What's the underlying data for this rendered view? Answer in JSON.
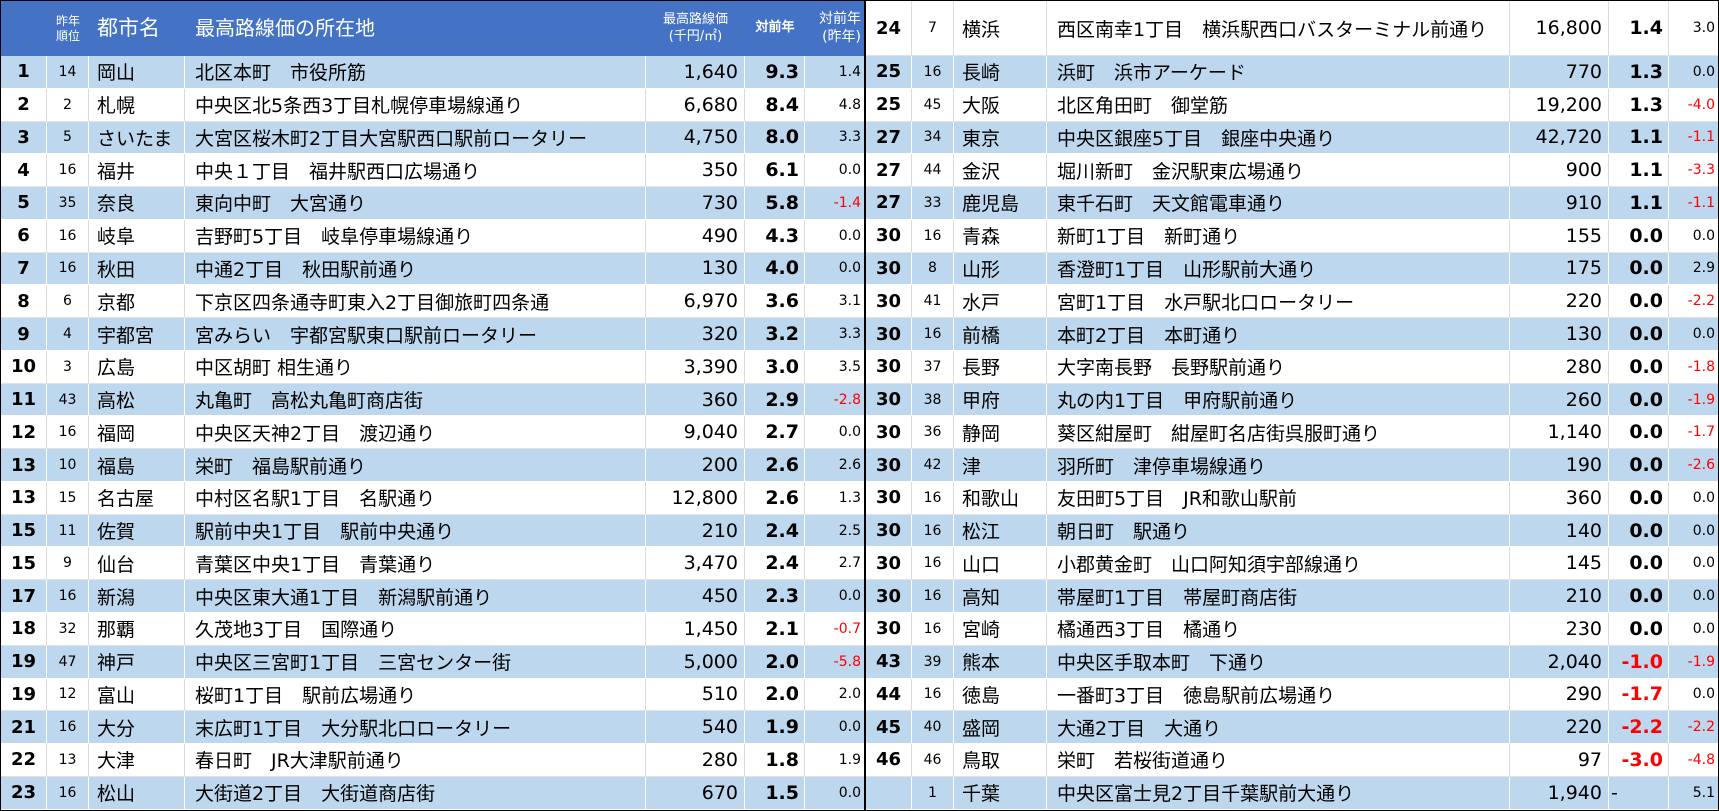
{
  "colors": {
    "header_bg": "#4472C4",
    "header_text": "#FFFFFF",
    "row_shade": "#BDD7EE",
    "negative": "#FF0000"
  },
  "header": {
    "prev_rank_line1": "昨年",
    "prev_rank_line2": "順位",
    "city": "都市名",
    "location": "最高路線価の所在地",
    "price_line1": "最高路線価",
    "price_line2": "(千円/㎡)",
    "yoy": "対前年",
    "yoy_prev_line1": "対前年",
    "yoy_prev_line2": "(昨年)"
  },
  "left_rows": [
    {
      "rank": "1",
      "prev_rank": "14",
      "city": "岡山",
      "location": "北区本町　市役所筋",
      "price": "1,640",
      "yoy": "9.3",
      "yoy_prev": "1.4"
    },
    {
      "rank": "2",
      "prev_rank": "2",
      "city": "札幌",
      "location": "中央区北5条西3丁目札幌停車場線通り",
      "price": "6,680",
      "yoy": "8.4",
      "yoy_prev": "4.8"
    },
    {
      "rank": "3",
      "prev_rank": "5",
      "city": "さいたま",
      "location": "大宮区桜木町2丁目大宮駅西口駅前ロータリー",
      "price": "4,750",
      "yoy": "8.0",
      "yoy_prev": "3.3"
    },
    {
      "rank": "4",
      "prev_rank": "16",
      "city": "福井",
      "location": "中央１丁目　福井駅西口広場通り",
      "price": "350",
      "yoy": "6.1",
      "yoy_prev": "0.0"
    },
    {
      "rank": "5",
      "prev_rank": "35",
      "city": "奈良",
      "location": "東向中町　大宮通り",
      "price": "730",
      "yoy": "5.8",
      "yoy_prev": "-1.4"
    },
    {
      "rank": "6",
      "prev_rank": "16",
      "city": "岐阜",
      "location": "吉野町5丁目　岐阜停車場線通り",
      "price": "490",
      "yoy": "4.3",
      "yoy_prev": "0.0"
    },
    {
      "rank": "7",
      "prev_rank": "16",
      "city": "秋田",
      "location": "中通2丁目　秋田駅前通り",
      "price": "130",
      "yoy": "4.0",
      "yoy_prev": "0.0"
    },
    {
      "rank": "8",
      "prev_rank": "6",
      "city": "京都",
      "location": "下京区四条通寺町東入2丁目御旅町四条通",
      "price": "6,970",
      "yoy": "3.6",
      "yoy_prev": "3.1"
    },
    {
      "rank": "9",
      "prev_rank": "4",
      "city": "宇都宮",
      "location": "宮みらい　宇都宮駅東口駅前ロータリー",
      "price": "320",
      "yoy": "3.2",
      "yoy_prev": "3.3"
    },
    {
      "rank": "10",
      "prev_rank": "3",
      "city": "広島",
      "location": "中区胡町 相生通り",
      "price": "3,390",
      "yoy": "3.0",
      "yoy_prev": "3.5"
    },
    {
      "rank": "11",
      "prev_rank": "43",
      "city": "高松",
      "location": "丸亀町　高松丸亀町商店街",
      "price": "360",
      "yoy": "2.9",
      "yoy_prev": "-2.8"
    },
    {
      "rank": "12",
      "prev_rank": "16",
      "city": "福岡",
      "location": "中央区天神2丁目　渡辺通り",
      "price": "9,040",
      "yoy": "2.7",
      "yoy_prev": "0.0"
    },
    {
      "rank": "13",
      "prev_rank": "10",
      "city": "福島",
      "location": "栄町　福島駅前通り",
      "price": "200",
      "yoy": "2.6",
      "yoy_prev": "2.6"
    },
    {
      "rank": "13",
      "prev_rank": "15",
      "city": "名古屋",
      "location": "中村区名駅1丁目　名駅通り",
      "price": "12,800",
      "yoy": "2.6",
      "yoy_prev": "1.3"
    },
    {
      "rank": "15",
      "prev_rank": "11",
      "city": "佐賀",
      "location": "駅前中央1丁目　駅前中央通り",
      "price": "210",
      "yoy": "2.4",
      "yoy_prev": "2.5"
    },
    {
      "rank": "15",
      "prev_rank": "9",
      "city": "仙台",
      "location": "青葉区中央1丁目　青葉通り",
      "price": "3,470",
      "yoy": "2.4",
      "yoy_prev": "2.7"
    },
    {
      "rank": "17",
      "prev_rank": "16",
      "city": "新潟",
      "location": "中央区東大通1丁目　新潟駅前通り",
      "price": "450",
      "yoy": "2.3",
      "yoy_prev": "0.0"
    },
    {
      "rank": "18",
      "prev_rank": "32",
      "city": "那覇",
      "location": "久茂地3丁目　国際通り",
      "price": "1,450",
      "yoy": "2.1",
      "yoy_prev": "-0.7"
    },
    {
      "rank": "19",
      "prev_rank": "47",
      "city": "神戸",
      "location": "中央区三宮町1丁目　三宮センター街",
      "price": "5,000",
      "yoy": "2.0",
      "yoy_prev": "-5.8"
    },
    {
      "rank": "19",
      "prev_rank": "12",
      "city": "富山",
      "location": "桜町1丁目　駅前広場通り",
      "price": "510",
      "yoy": "2.0",
      "yoy_prev": "2.0"
    },
    {
      "rank": "21",
      "prev_rank": "16",
      "city": "大分",
      "location": "末広町1丁目　大分駅北口ロータリー",
      "price": "540",
      "yoy": "1.9",
      "yoy_prev": "0.0"
    },
    {
      "rank": "22",
      "prev_rank": "13",
      "city": "大津",
      "location": "春日町　JR大津駅前通り",
      "price": "280",
      "yoy": "1.8",
      "yoy_prev": "1.9"
    },
    {
      "rank": "23",
      "prev_rank": "16",
      "city": "松山",
      "location": "大街道2丁目　大街道商店街",
      "price": "670",
      "yoy": "1.5",
      "yoy_prev": "0.0"
    }
  ],
  "right_rows": [
    {
      "rank": "24",
      "prev_rank": "7",
      "city": "横浜",
      "location": "西区南幸1丁目　横浜駅西口バスターミナル前通り",
      "price": "16,800",
      "yoy": "1.4",
      "yoy_prev": "3.0"
    },
    {
      "rank": "25",
      "prev_rank": "16",
      "city": "長崎",
      "location": "浜町　浜市アーケード",
      "price": "770",
      "yoy": "1.3",
      "yoy_prev": "0.0"
    },
    {
      "rank": "25",
      "prev_rank": "45",
      "city": "大阪",
      "location": "北区角田町　御堂筋",
      "price": "19,200",
      "yoy": "1.3",
      "yoy_prev": "-4.0"
    },
    {
      "rank": "27",
      "prev_rank": "34",
      "city": "東京",
      "location": "中央区銀座5丁目　銀座中央通り",
      "price": "42,720",
      "yoy": "1.1",
      "yoy_prev": "-1.1"
    },
    {
      "rank": "27",
      "prev_rank": "44",
      "city": "金沢",
      "location": "堀川新町　金沢駅東広場通り",
      "price": "900",
      "yoy": "1.1",
      "yoy_prev": "-3.3"
    },
    {
      "rank": "27",
      "prev_rank": "33",
      "city": "鹿児島",
      "location": "東千石町　天文館電車通り",
      "price": "910",
      "yoy": "1.1",
      "yoy_prev": "-1.1"
    },
    {
      "rank": "30",
      "prev_rank": "16",
      "city": "青森",
      "location": "新町1丁目　新町通り",
      "price": "155",
      "yoy": "0.0",
      "yoy_prev": "0.0"
    },
    {
      "rank": "30",
      "prev_rank": "8",
      "city": "山形",
      "location": "香澄町1丁目　山形駅前大通り",
      "price": "175",
      "yoy": "0.0",
      "yoy_prev": "2.9"
    },
    {
      "rank": "30",
      "prev_rank": "41",
      "city": "水戸",
      "location": "宮町1丁目　水戸駅北口ロータリー",
      "price": "220",
      "yoy": "0.0",
      "yoy_prev": "-2.2"
    },
    {
      "rank": "30",
      "prev_rank": "16",
      "city": "前橋",
      "location": "本町2丁目　本町通り",
      "price": "130",
      "yoy": "0.0",
      "yoy_prev": "0.0"
    },
    {
      "rank": "30",
      "prev_rank": "37",
      "city": "長野",
      "location": "大字南長野　長野駅前通り",
      "price": "280",
      "yoy": "0.0",
      "yoy_prev": "-1.8"
    },
    {
      "rank": "30",
      "prev_rank": "38",
      "city": "甲府",
      "location": "丸の内1丁目　甲府駅前通り",
      "price": "260",
      "yoy": "0.0",
      "yoy_prev": "-1.9"
    },
    {
      "rank": "30",
      "prev_rank": "36",
      "city": "静岡",
      "location": "葵区紺屋町　紺屋町名店街呉服町通り",
      "price": "1,140",
      "yoy": "0.0",
      "yoy_prev": "-1.7"
    },
    {
      "rank": "30",
      "prev_rank": "42",
      "city": "津",
      "location": "羽所町　津停車場線通り",
      "price": "190",
      "yoy": "0.0",
      "yoy_prev": "-2.6"
    },
    {
      "rank": "30",
      "prev_rank": "16",
      "city": "和歌山",
      "location": "友田町5丁目　JR和歌山駅前",
      "price": "360",
      "yoy": "0.0",
      "yoy_prev": "0.0"
    },
    {
      "rank": "30",
      "prev_rank": "16",
      "city": "松江",
      "location": "朝日町　駅通り",
      "price": "140",
      "yoy": "0.0",
      "yoy_prev": "0.0"
    },
    {
      "rank": "30",
      "prev_rank": "16",
      "city": "山口",
      "location": "小郡黄金町　山口阿知須宇部線通り",
      "price": "145",
      "yoy": "0.0",
      "yoy_prev": "0.0"
    },
    {
      "rank": "30",
      "prev_rank": "16",
      "city": "高知",
      "location": "帯屋町1丁目　帯屋町商店街",
      "price": "210",
      "yoy": "0.0",
      "yoy_prev": "0.0"
    },
    {
      "rank": "30",
      "prev_rank": "16",
      "city": "宮崎",
      "location": "橘通西3丁目　橘通り",
      "price": "230",
      "yoy": "0.0",
      "yoy_prev": "0.0"
    },
    {
      "rank": "43",
      "prev_rank": "39",
      "city": "熊本",
      "location": "中央区手取本町　下通り",
      "price": "2,040",
      "yoy": "-1.0",
      "yoy_prev": "-1.9"
    },
    {
      "rank": "44",
      "prev_rank": "16",
      "city": "徳島",
      "location": "一番町3丁目　徳島駅前広場通り",
      "price": "290",
      "yoy": "-1.7",
      "yoy_prev": "0.0"
    },
    {
      "rank": "45",
      "prev_rank": "40",
      "city": "盛岡",
      "location": "大通2丁目　大通り",
      "price": "220",
      "yoy": "-2.2",
      "yoy_prev": "-2.2"
    },
    {
      "rank": "46",
      "prev_rank": "46",
      "city": "鳥取",
      "location": "栄町　若桜街道通り",
      "price": "97",
      "yoy": "-3.0",
      "yoy_prev": "-4.8"
    },
    {
      "rank": "",
      "prev_rank": "1",
      "city": "千葉",
      "location": "中央区富士見2丁目千葉駅前大通り",
      "price": "1,940",
      "yoy": "-",
      "yoy_prev": "5.1"
    }
  ]
}
